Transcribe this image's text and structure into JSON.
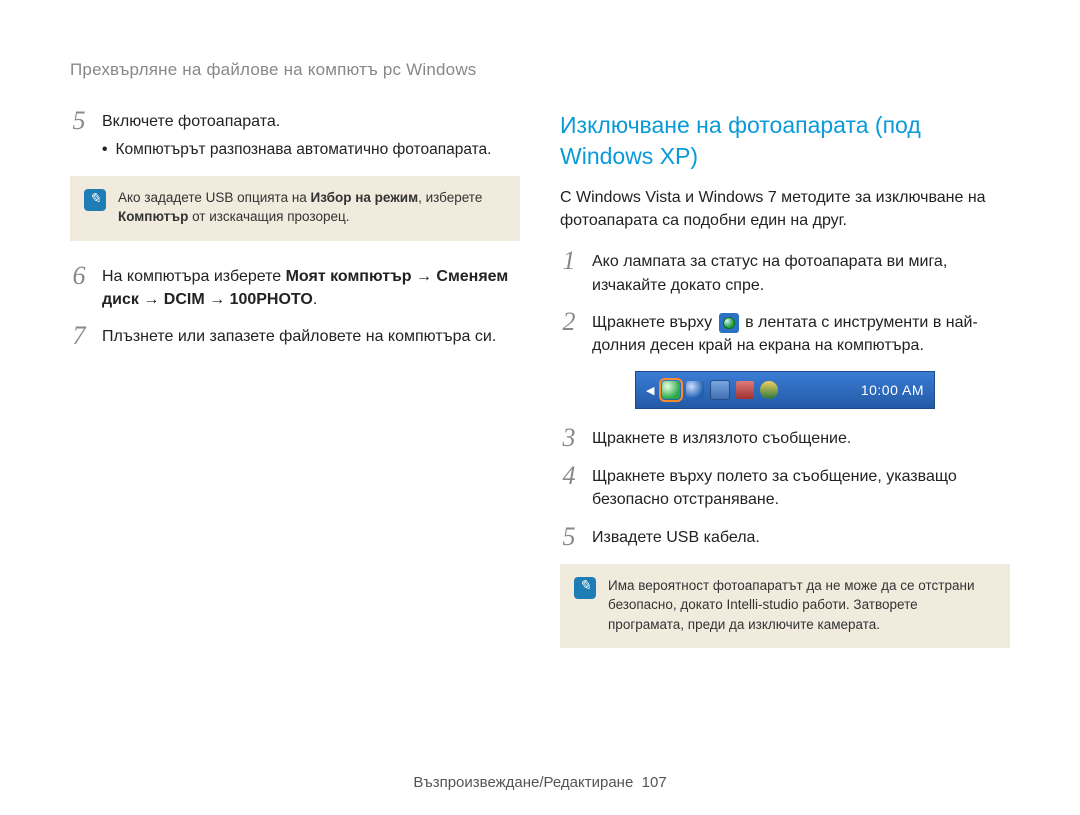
{
  "header": "Прехвърляне на файлове на компютъ рс Windows",
  "left": {
    "step5": {
      "num": "5",
      "text": "Включете фотоапарата.",
      "bullet_dot": "•",
      "bullet": "Компютърът разпознава автоматично фотоапарата."
    },
    "note": {
      "prefix": "Ако зададете USB опцията на ",
      "bold1": "Избор на режим",
      "mid": ", изберете ",
      "bold2": "Компютър",
      "suffix": " от изскачащия прозорец."
    },
    "step6": {
      "num": "6",
      "prefix": "На компютъра изберете ",
      "bold_path": "Моят компютър → Сменяем диск → DCIM → 100PHOTO"
    },
    "step7": {
      "num": "7",
      "text": "Плъзнете или запазете файловете на компютъра си."
    }
  },
  "right": {
    "title": "Изключване на фотоапарата (под Windows XP)",
    "intro": "С Windows Vista и Windows 7 методите за изключване на фотоапарата са подобни един на друг.",
    "step1": {
      "num": "1",
      "text": "Ако лампата за статус на фотоапарата ви мига, изчакайте докато спре."
    },
    "step2": {
      "num": "2",
      "prefix": "Щракнете върху ",
      "suffix": " в лентата с инструменти в най-долния десен край на екрана на компютъра."
    },
    "taskbar_time": "10:00 AM",
    "step3": {
      "num": "3",
      "text": "Щракнете в излязлото съобщение."
    },
    "step4": {
      "num": "4",
      "text": "Щракнете върху полето за съобщение, указващо безопасно отстраняване."
    },
    "step5": {
      "num": "5",
      "text": "Извадете USB кабела."
    },
    "note": "Има вероятност фотоапаратът да не може да се отстрани безопасно, докато Intelli-studio работи. Затворете програмата, преди да изключите камерата."
  },
  "footer": {
    "label": "Възпроизвеждане/Редактиране",
    "page": "107"
  }
}
